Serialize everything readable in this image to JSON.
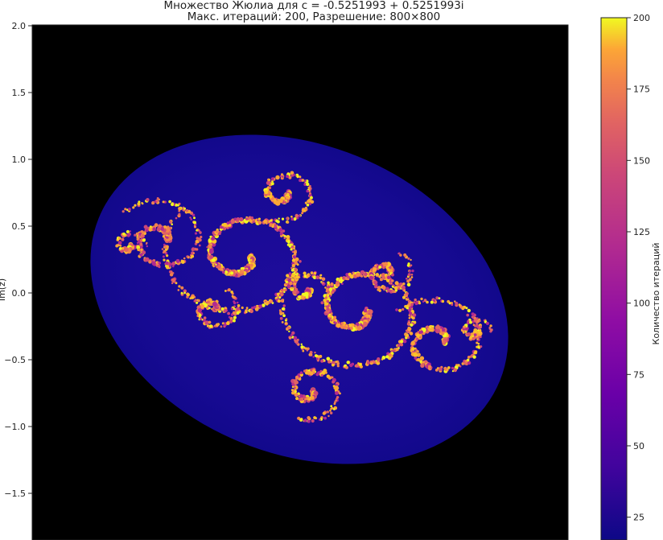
{
  "title_line1": "Множество Жюлиа для c = -0.5251993 + 0.5251993i",
  "title_line2": "Макс. итераций: 200, Разрешение: 800×800",
  "chart_data": {
    "type": "heatmap",
    "title": "Множество Жюлиа для c = -0.5251993 + 0.5251993i",
    "subtitle": "Макс. итераций: 200, Разрешение: 800×800",
    "c_real": -0.5251993,
    "c_imag": 0.5251993,
    "max_iterations": 200,
    "resolution": "800×800",
    "ylabel": "Im(z)",
    "ylim_visible": [
      -1.83,
      2.0
    ],
    "y_ticks": [
      2.0,
      1.5,
      1.0,
      0.5,
      0.0,
      -0.5,
      -1.0,
      -1.5
    ],
    "y_tick_labels": [
      "2.0",
      "1.5",
      "1.0",
      "0.5",
      "0.0",
      "−0.5",
      "−1.0",
      "−1.5"
    ],
    "colormap": "plasma",
    "colorbar": {
      "label": "Количество итераций",
      "range_visible": [
        17,
        200
      ],
      "ticks": [
        200,
        175,
        150,
        125,
        100,
        75,
        50,
        25
      ],
      "tick_labels": [
        "200",
        "175",
        "150",
        "125",
        "100",
        "75",
        "50",
        "25"
      ]
    },
    "colors": {
      "set_interior": "#000000",
      "low_escape": "#0d0887",
      "high_escape": "#f0f921"
    },
    "grid": false
  }
}
